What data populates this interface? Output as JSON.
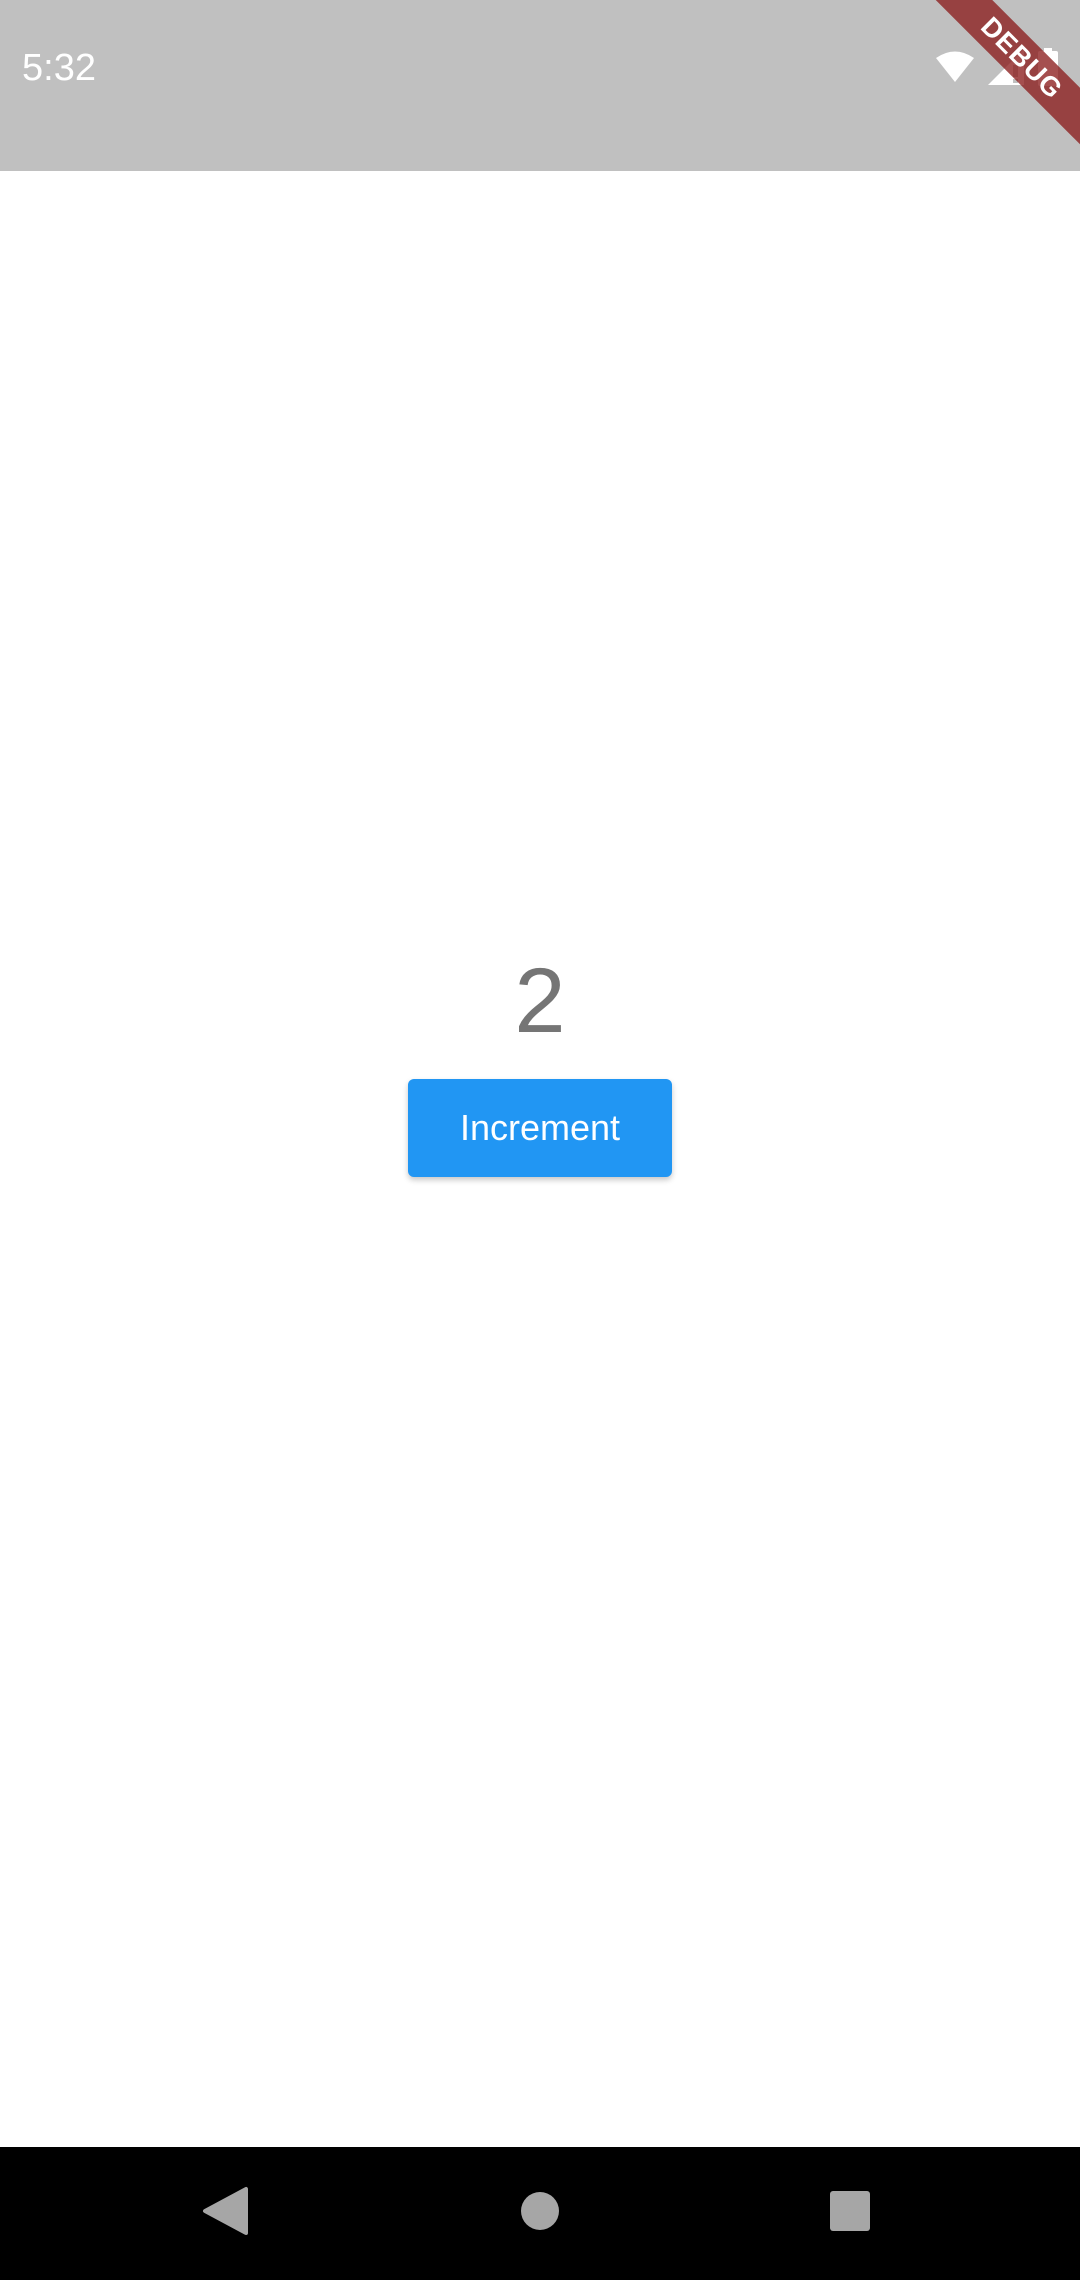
{
  "status_bar": {
    "time": "5:32",
    "icons": [
      "wifi-icon",
      "cellular-signal-icon",
      "battery-icon"
    ],
    "background_color": "#c0c0c0"
  },
  "debug_banner": {
    "label": "DEBUG",
    "color": "#8c1e1e"
  },
  "main": {
    "counter_value": "2",
    "increment_label": "Increment",
    "accent_color": "#2196f3"
  },
  "nav_bar": {
    "buttons": [
      "back-icon",
      "home-icon",
      "recents-icon"
    ]
  }
}
